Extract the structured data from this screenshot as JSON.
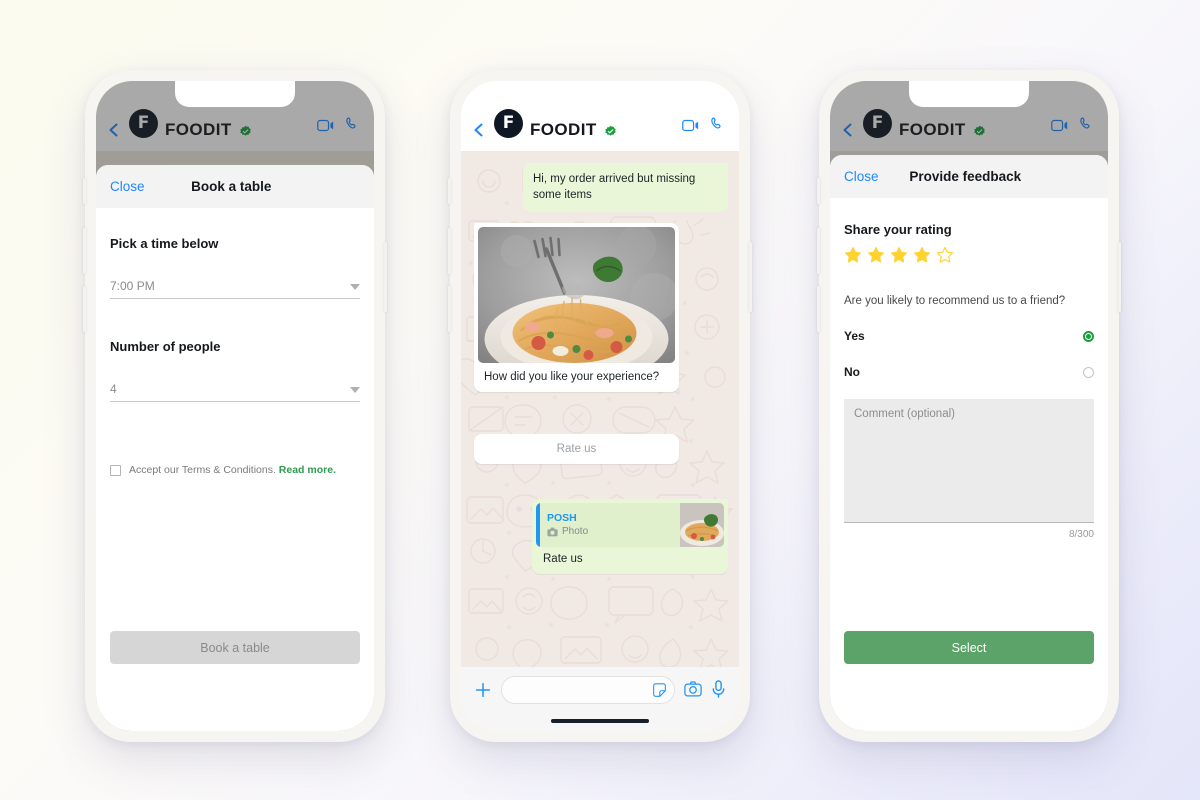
{
  "brand": {
    "name": "FOODIT",
    "avatar_letter": "F",
    "verified_icon": "verified-badge-icon",
    "accent_blue": "#1e88ff",
    "accent_green": "#5ba368",
    "link_green": "#2e9b4f"
  },
  "topbar": {
    "back_icon": "back-chevron-icon",
    "video_icon": "video-call-icon",
    "phone_icon": "voice-call-icon"
  },
  "phone1": {
    "sheet": {
      "close_label": "Close",
      "title": "Book a table",
      "time_label": "Pick a time below",
      "time_value": "7:00 PM",
      "people_label": "Number of people",
      "people_value": "4",
      "terms_text": "Accept our Terms & Conditions.",
      "terms_link": "Read more.",
      "checkbox_checked": false,
      "submit_label": "Book a table",
      "submit_enabled": false,
      "dropdown_icon": "chevron-down-icon"
    }
  },
  "phone2": {
    "chat": {
      "outgoing_message": "Hi, my order arrived but missing some items",
      "card_caption": "How did you like your experience?",
      "card_button_label": "Rate us",
      "reply_quote_name": "POSH",
      "reply_quote_subtitle": "Photo",
      "reply_quote_icon": "camera-icon",
      "reply_message": "Rate us"
    },
    "inputbar": {
      "plus_icon": "plus-icon",
      "message_placeholder": "",
      "sticker_icon": "sticker-icon",
      "camera_icon": "camera-icon",
      "mic_icon": "microphone-icon"
    }
  },
  "phone3": {
    "sheet": {
      "close_label": "Close",
      "title": "Provide feedback",
      "rating_heading": "Share your rating",
      "rating_value": 4,
      "rating_max": 5,
      "star_icon": "star-icon",
      "question": "Are you likely to recommend us to a friend?",
      "options": [
        {
          "label": "Yes",
          "selected": true
        },
        {
          "label": "No",
          "selected": false
        }
      ],
      "comment_placeholder": "Comment (optional)",
      "comment_value": "",
      "char_count": "8/300",
      "submit_label": "Select"
    }
  }
}
